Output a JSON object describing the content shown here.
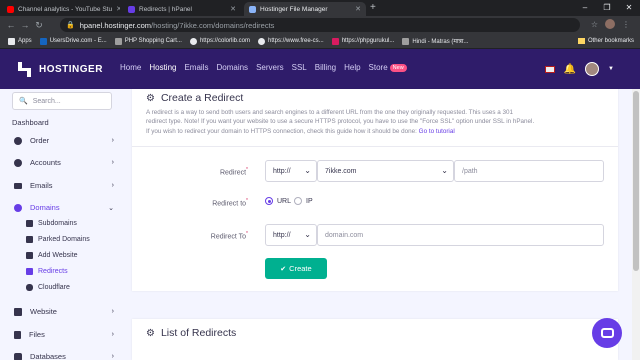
{
  "browser": {
    "tabs": [
      {
        "title": "Channel analytics - YouTube Stu",
        "color": "#ff0000",
        "active": false
      },
      {
        "title": "Redirects | hPanel",
        "color": "#673de6",
        "active": false
      },
      {
        "title": "Hostinger File Manager",
        "color": "#1a73e8",
        "active": true
      }
    ],
    "new_tab": "+",
    "window_controls": [
      "–",
      "❐",
      "✕"
    ],
    "nav": [
      "←",
      "→",
      "↻"
    ],
    "url_host": "hpanel.hostinger.com",
    "url_path": "/hosting/7ikke.com/domains/redirects",
    "bookmarks": [
      {
        "label": "Apps",
        "color": "#e8eaed"
      },
      {
        "label": "UsersDrive.com - E...",
        "color": "#1565c0"
      },
      {
        "label": "PHP Shopping Cart...",
        "color": "#9e9e9e"
      },
      {
        "label": "https://colorlib.com",
        "color": "#e8eaed"
      },
      {
        "label": "https://www.free-cs...",
        "color": "#e8eaed"
      },
      {
        "label": "https://phpgurukul...",
        "color": "#d81b60"
      },
      {
        "label": "Hindi - Matras (मात्रा...",
        "color": "#9e9e9e"
      }
    ],
    "other_bookmarks": "Other bookmarks"
  },
  "header": {
    "brand": "HOSTINGER",
    "menu": [
      "Home",
      "Hosting",
      "Emails",
      "Domains",
      "Servers",
      "SSL",
      "Billing",
      "Help",
      "Store"
    ],
    "current": "Hosting",
    "new_badge": "New"
  },
  "sidebar": {
    "search_placeholder": "Search...",
    "dashboard": "Dashboard",
    "items": [
      {
        "label": "Order",
        "icon": "info-icon"
      },
      {
        "label": "Accounts",
        "icon": "info-icon"
      },
      {
        "label": "Emails",
        "icon": "mail-icon"
      },
      {
        "label": "Domains",
        "icon": "globe-icon"
      },
      {
        "label": "Website",
        "icon": "monitor-icon"
      },
      {
        "label": "Files",
        "icon": "file-icon"
      },
      {
        "label": "Databases",
        "icon": "database-icon"
      }
    ],
    "subitems": [
      "Subdomains",
      "Parked Domains",
      "Add Website",
      "Redirects",
      "Cloudflare"
    ],
    "active_subitem": "Redirects"
  },
  "create": {
    "title": "Create a Redirect",
    "description_lines": [
      "A redirect is a way to send both users and search engines to a different URL from the one they originally requested. This uses a 301",
      "redirect type. Note! If you want your website to use a secure HTTPS protocol, you have to use the \"Force SSL\" option under SSL in hPanel.",
      "If you wish to redirect your domain to HTTPS connection, check this guide how it should be done:"
    ],
    "guide_link": "Go to tutorial",
    "redirect_label": "Redirect",
    "protocol": "http://",
    "domain": "7ikke.com",
    "path_placeholder": "/path",
    "redirect_to_label": "Redirect to",
    "radio_options": [
      "URL",
      "IP"
    ],
    "selected_radio": "URL",
    "redirect_to_url_label": "Redirect To",
    "to_protocol": "http://",
    "to_placeholder": "domain.com",
    "create_button": "Create"
  },
  "list": {
    "title": "List of Redirects"
  },
  "colors": {
    "primary": "#673de6",
    "header_bg": "#2f1c6a",
    "create_button": "#00b090",
    "page_bg": "#f4f5ff"
  }
}
